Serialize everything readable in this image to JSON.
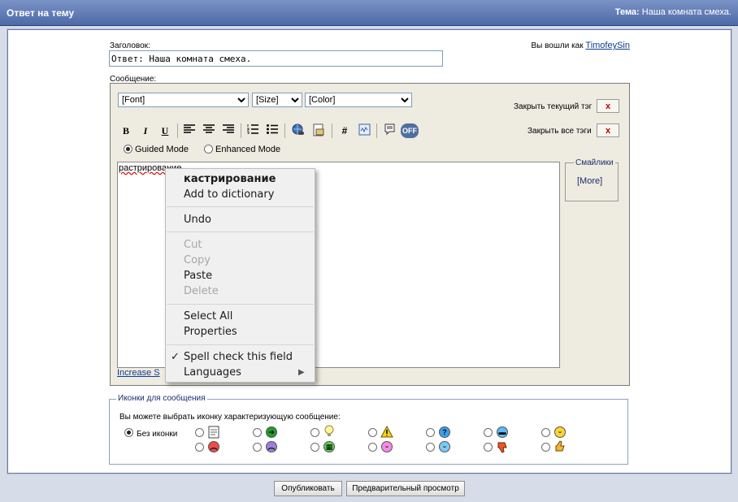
{
  "header": {
    "title": "Ответ на тему",
    "topic_label": "Тема:",
    "topic_value": "Наша комната смеха."
  },
  "form": {
    "subject_label": "Заголовок:",
    "subject_value": "Ответ: Наша комната смеха.",
    "logged_in_text": "Вы вошли как",
    "username": "TimofeySin",
    "message_label": "Сообщение:"
  },
  "editor": {
    "font_select": "[Font]",
    "size_select": "[Size]",
    "color_select": "[Color]",
    "close_current_tag_label": "Закрыть текущий тэг",
    "close_all_tags_label": "Закрыть все тэги",
    "close_symbol": "x",
    "toolbar": {
      "bold": "B",
      "italic": "I",
      "underline": "U",
      "hash": "#",
      "off": "OFF"
    },
    "mode_guided": "Guided Mode",
    "mode_enhanced": "Enhanced Mode",
    "selected_mode": "guided",
    "text_content": "растрирование",
    "increase_link": "Increase S",
    "smileys_legend": "Смайлики",
    "smileys_more": "[More]"
  },
  "context_menu": {
    "suggestion": "кастрирование",
    "add_to_dictionary": "Add to dictionary",
    "undo": "Undo",
    "cut": "Cut",
    "copy": "Copy",
    "paste": "Paste",
    "delete": "Delete",
    "select_all": "Select All",
    "properties": "Properties",
    "spell_check_mark": "✓",
    "spell_check": "Spell check this field",
    "spell_check_checked": true,
    "languages": "Languages",
    "submenu_arrow": "▶"
  },
  "message_icons": {
    "legend": "Иконки для сообщения",
    "hint": "Вы можете выбрать иконку характеризующую сообщение:",
    "no_icon": "Без иконки",
    "selected": "no_icon",
    "icons_row1": [
      "note-icon",
      "arrow-right-icon",
      "lightbulb-icon",
      "warning-icon",
      "question-icon",
      "cool-icon",
      "smile-icon"
    ],
    "icons_row2": [
      "angry-icon",
      "sad-icon",
      "grin-icon",
      "tongue-icon",
      "happy-icon",
      "thumbs-down-icon",
      "thumbs-up-icon"
    ]
  },
  "buttons": {
    "publish": "Опубликовать",
    "preview": "Предварительный просмотр"
  },
  "colors": {
    "header_bg": "#4e69a8",
    "editor_bg": "#eeebe0",
    "close_x": "#c00000",
    "link": "#0b3d91"
  }
}
